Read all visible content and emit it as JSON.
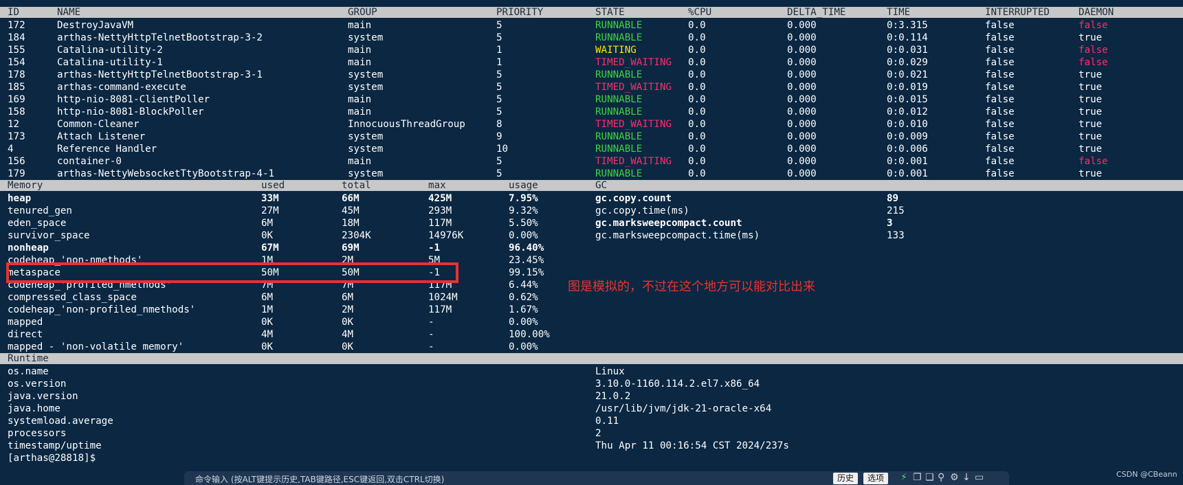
{
  "threads": {
    "headers": {
      "id": "ID",
      "name": "NAME",
      "group": "GROUP",
      "priority": "PRIORITY",
      "state": "STATE",
      "cpu": "%CPU",
      "delta": "DELTA_TIME",
      "time": "TIME",
      "interrupted": "INTERRUPTED",
      "daemon": "DAEMON"
    },
    "rows": [
      {
        "id": "172",
        "name": "DestroyJavaVM",
        "group": "main",
        "priority": "5",
        "state": "RUNNABLE",
        "cpu": "0.0",
        "delta": "0.000",
        "time": "0:3.315",
        "interrupted": "false",
        "daemon": "false"
      },
      {
        "id": "184",
        "name": "arthas-NettyHttpTelnetBootstrap-3-2",
        "group": "system",
        "priority": "5",
        "state": "RUNNABLE",
        "cpu": "0.0",
        "delta": "0.000",
        "time": "0:0.114",
        "interrupted": "false",
        "daemon": "true"
      },
      {
        "id": "155",
        "name": "Catalina-utility-2",
        "group": "main",
        "priority": "1",
        "state": "WAITING",
        "cpu": "0.0",
        "delta": "0.000",
        "time": "0:0.031",
        "interrupted": "false",
        "daemon": "false"
      },
      {
        "id": "154",
        "name": "Catalina-utility-1",
        "group": "main",
        "priority": "1",
        "state": "TIMED_WAITING",
        "cpu": "0.0",
        "delta": "0.000",
        "time": "0:0.029",
        "interrupted": "false",
        "daemon": "false"
      },
      {
        "id": "178",
        "name": "arthas-NettyHttpTelnetBootstrap-3-1",
        "group": "system",
        "priority": "5",
        "state": "RUNNABLE",
        "cpu": "0.0",
        "delta": "0.000",
        "time": "0:0.021",
        "interrupted": "false",
        "daemon": "true"
      },
      {
        "id": "185",
        "name": "arthas-command-execute",
        "group": "system",
        "priority": "5",
        "state": "TIMED_WAITING",
        "cpu": "0.0",
        "delta": "0.000",
        "time": "0:0.019",
        "interrupted": "false",
        "daemon": "true"
      },
      {
        "id": "169",
        "name": "http-nio-8081-ClientPoller",
        "group": "main",
        "priority": "5",
        "state": "RUNNABLE",
        "cpu": "0.0",
        "delta": "0.000",
        "time": "0:0.015",
        "interrupted": "false",
        "daemon": "true"
      },
      {
        "id": "158",
        "name": "http-nio-8081-BlockPoller",
        "group": "main",
        "priority": "5",
        "state": "RUNNABLE",
        "cpu": "0.0",
        "delta": "0.000",
        "time": "0:0.012",
        "interrupted": "false",
        "daemon": "true"
      },
      {
        "id": "12",
        "name": "Common-Cleaner",
        "group": "InnocuousThreadGroup",
        "priority": "8",
        "state": "TIMED_WAITING",
        "cpu": "0.0",
        "delta": "0.000",
        "time": "0:0.010",
        "interrupted": "false",
        "daemon": "true"
      },
      {
        "id": "173",
        "name": "Attach Listener",
        "group": "system",
        "priority": "9",
        "state": "RUNNABLE",
        "cpu": "0.0",
        "delta": "0.000",
        "time": "0:0.009",
        "interrupted": "false",
        "daemon": "true"
      },
      {
        "id": "4",
        "name": "Reference Handler",
        "group": "system",
        "priority": "10",
        "state": "RUNNABLE",
        "cpu": "0.0",
        "delta": "0.000",
        "time": "0:0.006",
        "interrupted": "false",
        "daemon": "true"
      },
      {
        "id": "156",
        "name": "container-0",
        "group": "main",
        "priority": "5",
        "state": "TIMED_WAITING",
        "cpu": "0.0",
        "delta": "0.000",
        "time": "0:0.001",
        "interrupted": "false",
        "daemon": "false"
      },
      {
        "id": "179",
        "name": "arthas-NettyWebsocketTtyBootstrap-4-1",
        "group": "system",
        "priority": "5",
        "state": "RUNNABLE",
        "cpu": "0.0",
        "delta": "0.000",
        "time": "0:0.001",
        "interrupted": "false",
        "daemon": "true"
      }
    ]
  },
  "memory": {
    "headers": {
      "memory": "Memory",
      "used": "used",
      "total": "total",
      "max": "max",
      "usage": "usage",
      "gc": "GC"
    },
    "rows": [
      {
        "name": "heap",
        "used": "33M",
        "total": "66M",
        "max": "425M",
        "usage": "7.95%",
        "bold": true
      },
      {
        "name": "tenured_gen",
        "used": "27M",
        "total": "45M",
        "max": "293M",
        "usage": "9.32%"
      },
      {
        "name": "eden_space",
        "used": "6M",
        "total": "18M",
        "max": "117M",
        "usage": "5.50%"
      },
      {
        "name": "survivor_space",
        "used": "0K",
        "total": "2304K",
        "max": "14976K",
        "usage": "0.00%"
      },
      {
        "name": "nonheap",
        "used": "67M",
        "total": "69M",
        "max": "-1",
        "usage": "96.40%",
        "bold": true
      },
      {
        "name": "codeheap_'non-nmethods'",
        "used": "1M",
        "total": "2M",
        "max": "5M",
        "usage": "23.45%"
      },
      {
        "name": "metaspace",
        "used": "50M",
        "total": "50M",
        "max": "-1",
        "usage": "99.15%"
      },
      {
        "name": "codeheap_'profiled_nmethods'",
        "used": "7M",
        "total": "7M",
        "max": "117M",
        "usage": "6.44%"
      },
      {
        "name": "compressed_class_space",
        "used": "6M",
        "total": "6M",
        "max": "1024M",
        "usage": "0.62%"
      },
      {
        "name": "codeheap_'non-profiled_nmethods'",
        "used": "1M",
        "total": "2M",
        "max": "117M",
        "usage": "1.67%"
      },
      {
        "name": "mapped",
        "used": "0K",
        "total": "0K",
        "max": "-",
        "usage": "0.00%"
      },
      {
        "name": "direct",
        "used": "4M",
        "total": "4M",
        "max": "-",
        "usage": "100.00%"
      },
      {
        "name": "mapped - 'non-volatile memory'",
        "used": "0K",
        "total": "0K",
        "max": "-",
        "usage": "0.00%"
      }
    ],
    "gc": [
      {
        "name": "gc.copy.count",
        "value": "89",
        "bold": true
      },
      {
        "name": "gc.copy.time(ms)",
        "value": "215"
      },
      {
        "name": "gc.marksweepcompact.count",
        "value": "3",
        "bold": true
      },
      {
        "name": "gc.marksweepcompact.time(ms)",
        "value": "133"
      }
    ]
  },
  "runtime": {
    "header": "Runtime",
    "rows": [
      {
        "name": "os.name",
        "value": "Linux"
      },
      {
        "name": "os.version",
        "value": "3.10.0-1160.114.2.el7.x86_64"
      },
      {
        "name": "java.version",
        "value": "21.0.2"
      },
      {
        "name": "java.home",
        "value": "/usr/lib/jvm/jdk-21-oracle-x64"
      },
      {
        "name": "systemload.average",
        "value": "0.11"
      },
      {
        "name": "processors",
        "value": "2"
      },
      {
        "name": "timestamp/uptime",
        "value": "Thu Apr 11 00:16:54 CST 2024/237s"
      }
    ]
  },
  "prompt": "[arthas@28818]$",
  "annotation": "图是模拟的，不过在这个地方可以能对比出来",
  "cmdbar": {
    "hint": "命令输入 (按ALT键提示历史,TAB键路径,ESC键返回,双击CTRL切换)",
    "history_label": "历史",
    "options_label": "选项"
  },
  "watermark": "CSDN @CBeann",
  "colors": {
    "background": "#0b2742",
    "header_bar": "#c8c8c8",
    "runnable": "#3fd43f",
    "waiting": "#ffe600",
    "timed_waiting": "#ff2d6b",
    "highlight_box": "#e63232"
  }
}
